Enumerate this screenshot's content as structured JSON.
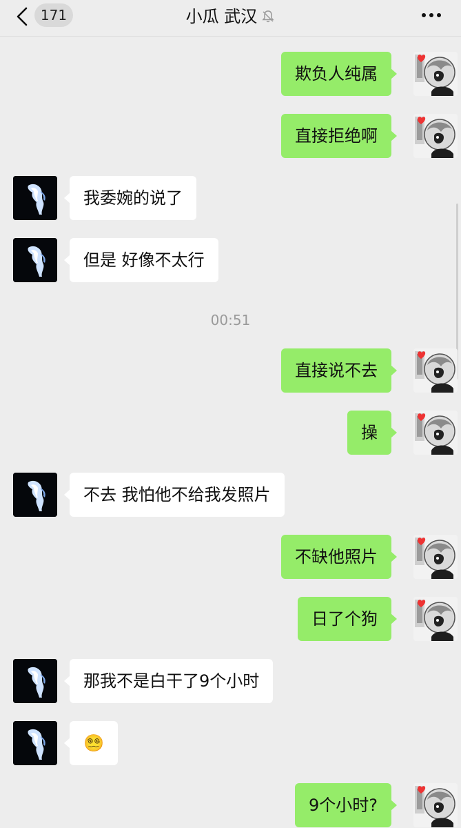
{
  "header": {
    "unread_count": "171",
    "title": "小瓜 武汉"
  },
  "messages": [
    {
      "side": "right",
      "text": "欺负人纯属"
    },
    {
      "side": "right",
      "text": "直接拒绝啊"
    },
    {
      "side": "left",
      "text": "我委婉的说了"
    },
    {
      "side": "left",
      "text": "但是 好像不太行"
    },
    {
      "side": "time",
      "text": "00:51"
    },
    {
      "side": "right",
      "text": "直接说不去"
    },
    {
      "side": "right",
      "text": "操"
    },
    {
      "side": "left",
      "text": "不去 我怕他不给我发照片"
    },
    {
      "side": "right",
      "text": "不缺他照片"
    },
    {
      "side": "right",
      "text": "日了个狗"
    },
    {
      "side": "left",
      "text": "那我不是白干了9个小时"
    },
    {
      "side": "left",
      "text": "😵‍💫"
    },
    {
      "side": "right",
      "text": "9个小时?"
    }
  ],
  "colors": {
    "background": "#ededed",
    "sent_bubble": "#95ec69",
    "received_bubble": "#ffffff"
  }
}
